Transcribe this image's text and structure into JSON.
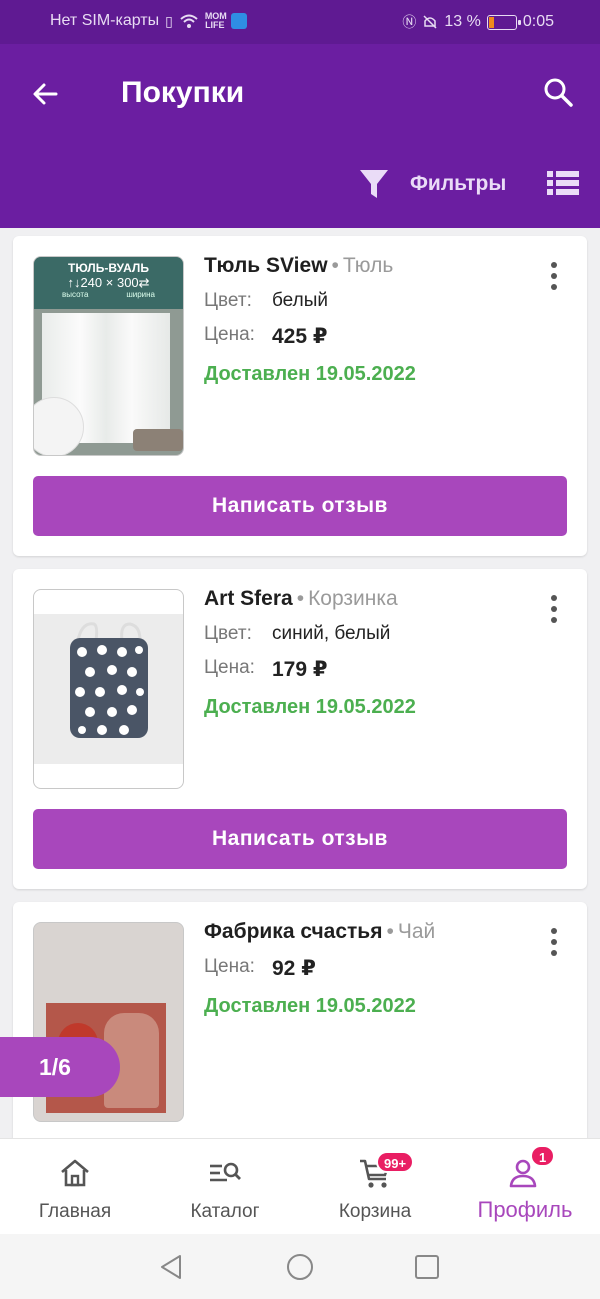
{
  "status_bar": {
    "carrier": "Нет SIM-карты",
    "battery": "13 %",
    "battery_level": 0.13,
    "time": "0:05"
  },
  "app_bar": {
    "title": "Покупки",
    "filters_label": "Фильтры",
    "icons": [
      "arrow-back-icon",
      "search-icon",
      "filter-icon",
      "list-view-icon"
    ]
  },
  "purchases": [
    {
      "brand": "Тюль SView",
      "category": "Тюль",
      "color_label": "Цвет:",
      "color": "белый",
      "price_label": "Цена:",
      "price": "425 ₽",
      "status": "Доставлен 19.05.2022",
      "review_button": "Написать отзыв",
      "thumb_caption": "ТЮЛЬ-ВУАЛЬ",
      "thumb_dims": "↑↓240 × 300⇄",
      "thumb_sub_left": "высота",
      "thumb_sub_right": "ширина"
    },
    {
      "brand": "Art Sfera",
      "category": "Корзинка",
      "color_label": "Цвет:",
      "color": "синий, белый",
      "price_label": "Цена:",
      "price": "179 ₽",
      "status": "Доставлен 19.05.2022",
      "review_button": "Написать отзыв"
    },
    {
      "brand": "Фабрика счастья",
      "category": "Чай",
      "price_label": "Цена:",
      "price": "92 ₽",
      "status": "Доставлен 19.05.2022"
    }
  ],
  "pager": "1/6",
  "bottom_nav": [
    {
      "label": "Главная",
      "icon": "home-icon"
    },
    {
      "label": "Каталог",
      "icon": "catalog-search-icon"
    },
    {
      "label": "Корзина",
      "icon": "cart-icon",
      "badge": "99+"
    },
    {
      "label": "Профиль",
      "icon": "profile-icon",
      "badge": "1",
      "active": true
    }
  ],
  "colors": {
    "status_bar": "#5f1a92",
    "app_bar": "#6b1ea1",
    "accent": "#a847bc",
    "delivered": "#4caf50",
    "badge": "#e91e63"
  }
}
